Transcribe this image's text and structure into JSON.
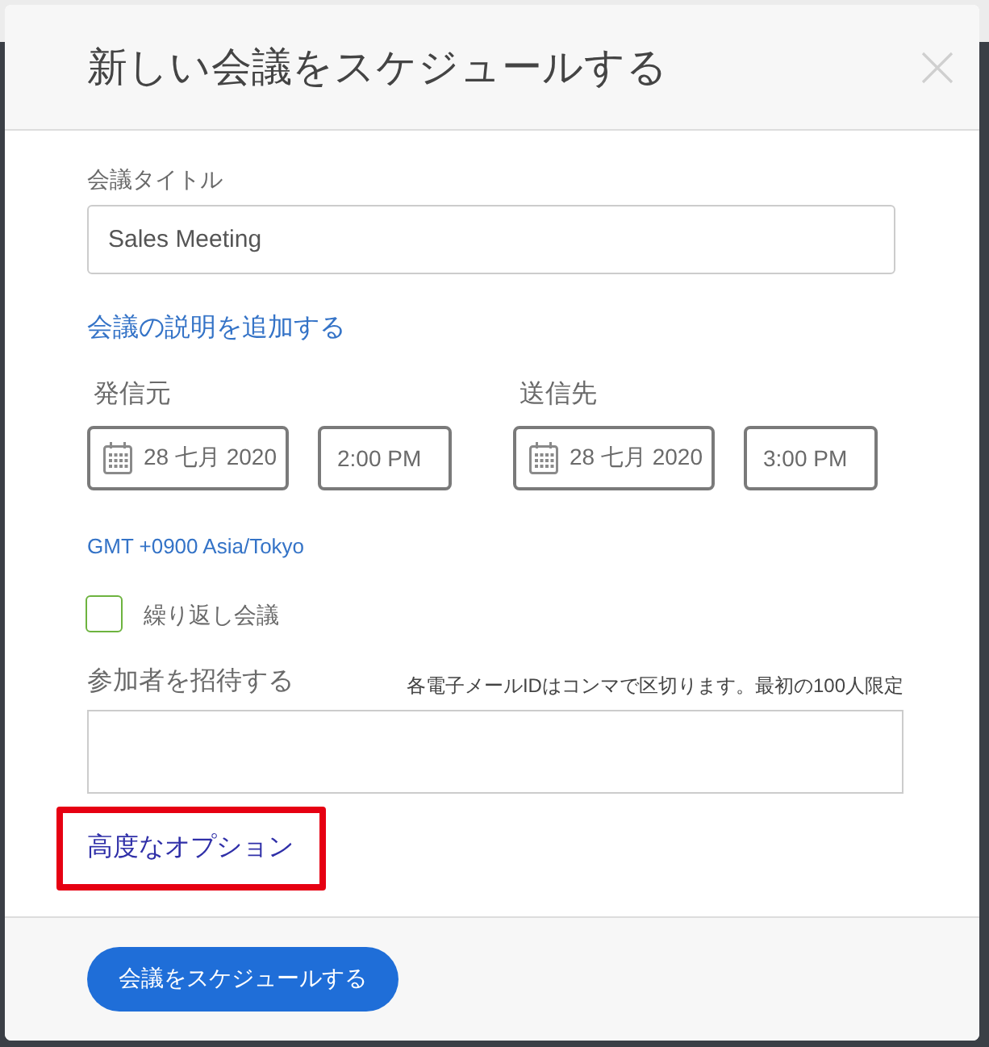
{
  "dialog": {
    "title": "新しい会議をスケジュールする"
  },
  "title_field": {
    "label": "会議タイトル",
    "value": "Sales Meeting"
  },
  "description_link": "会議の説明を追加する",
  "schedule": [
    {
      "label": "発信元",
      "date": "28 七月 2020",
      "time": "2:00 PM"
    },
    {
      "label": "送信先",
      "date": "28 七月 2020",
      "time": "3:00 PM"
    }
  ],
  "timezone_link": "GMT +0900 Asia/Tokyo",
  "recurring": {
    "label": "繰り返し会議",
    "checked": false
  },
  "invite": {
    "label": "参加者を招待する",
    "hint": "各電子メールIDはコンマで区切ります。最初の100人限定"
  },
  "advanced_options": {
    "label": "高度なオプション",
    "highlighted": true
  },
  "footer": {
    "button": "会議をスケジュールする"
  }
}
